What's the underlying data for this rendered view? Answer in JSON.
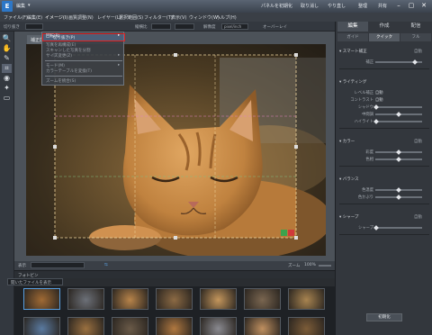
{
  "app": {
    "logo_text": "E",
    "title": "編集",
    "title_menu_arrow": "▾",
    "colors": {
      "accent": "#2d77c7",
      "highlight_box": "#e02020"
    }
  },
  "titlebar": {
    "items": [
      "パネルを初期化",
      "取り消し",
      "やり直し",
      "整理",
      "共有"
    ],
    "window_buttons": [
      "–",
      "▢",
      "✕"
    ]
  },
  "menubar": {
    "items": [
      "ファイル(F)",
      "編集(E)",
      "イメージ(I)",
      "画質調整(N)",
      "レイヤー(L)",
      "選択範囲(S)",
      "フィルター(T)",
      "表示(V)",
      "ウィンドウ(W)",
      "ヘルプ(H)"
    ]
  },
  "options": {
    "mode_label": "切り抜き",
    "tool_label": "縦横比",
    "resolution_label": "解像度",
    "unit_value": "pixel/inch",
    "extra_label": "オーバーレイ"
  },
  "tools": [
    {
      "name": "zoom-tool-icon",
      "glyph": "🔍"
    },
    {
      "name": "hand-tool-icon",
      "glyph": "✋"
    },
    {
      "name": "quick-select-icon",
      "glyph": "✎"
    },
    {
      "name": "crop-tool-icon",
      "glyph": "⌗"
    },
    {
      "name": "red-eye-icon",
      "glyph": "◉"
    },
    {
      "name": "whiten-teeth-icon",
      "glyph": "✦"
    },
    {
      "name": "straighten-icon",
      "glyph": "▭"
    }
  ],
  "document": {
    "tab_label": "補正前"
  },
  "dropdown": {
    "items": [
      {
        "label": "回転(R)",
        "arrow": "▸",
        "dim": false
      },
      {
        "label": "切り抜き(P)",
        "arrow": "",
        "dim": false,
        "highlight": true
      },
      {
        "label": "写真を再構成(E)",
        "arrow": "",
        "dim": true
      },
      {
        "label": "スキャンした写真を分割",
        "arrow": "",
        "dim": true
      },
      {
        "label": "サイズ変更(Z)",
        "arrow": "▸",
        "dim": true
      },
      {
        "label": "モード(M)",
        "arrow": "▸",
        "dim": true
      },
      {
        "label": "カラーテーブルを変換(T)",
        "arrow": "",
        "dim": true
      },
      {
        "label": "ズームを統合(S)",
        "arrow": "",
        "dim": true
      }
    ]
  },
  "zoombar": {
    "view_label": "表示",
    "zoom_label": "ズーム",
    "zoom_value": "100%"
  },
  "bin": {
    "title": "フォトビン",
    "select_value": "開いたファイルを表示",
    "thumb_count": 14
  },
  "rpanel": {
    "tabs": [
      "編集",
      "作成",
      "配信"
    ],
    "subtabs": [
      "ガイド",
      "クイック",
      "フル"
    ],
    "sections": [
      {
        "title": "スマート補正",
        "reset": "自動",
        "rows": [
          {
            "label": "補正",
            "type": "slider",
            "pos": 0.85
          }
        ]
      },
      {
        "title": "ライティング",
        "reset": "",
        "rows": [
          {
            "label": "レベル補正",
            "type": "auto",
            "value": "自動"
          },
          {
            "label": "コントラスト",
            "type": "auto",
            "value": "自動"
          },
          {
            "label": "シャドウ",
            "type": "slider",
            "pos": 0.0
          },
          {
            "label": "中間調",
            "type": "slider",
            "pos": 0.5
          },
          {
            "label": "ハイライト",
            "type": "slider",
            "pos": 0.0
          }
        ]
      },
      {
        "title": "カラー",
        "reset": "自動",
        "rows": [
          {
            "label": "彩度",
            "type": "slider",
            "pos": 0.5
          },
          {
            "label": "色相",
            "type": "slider",
            "pos": 0.5
          }
        ]
      },
      {
        "title": "バランス",
        "reset": "",
        "rows": [
          {
            "label": "色温度",
            "type": "slider",
            "pos": 0.5
          },
          {
            "label": "色かぶり",
            "type": "slider",
            "pos": 0.5
          }
        ]
      },
      {
        "title": "シャープ",
        "reset": "自動",
        "rows": [
          {
            "label": "シャープ",
            "type": "slider",
            "pos": 0.0
          }
        ]
      }
    ],
    "reset_button": "初期化"
  }
}
